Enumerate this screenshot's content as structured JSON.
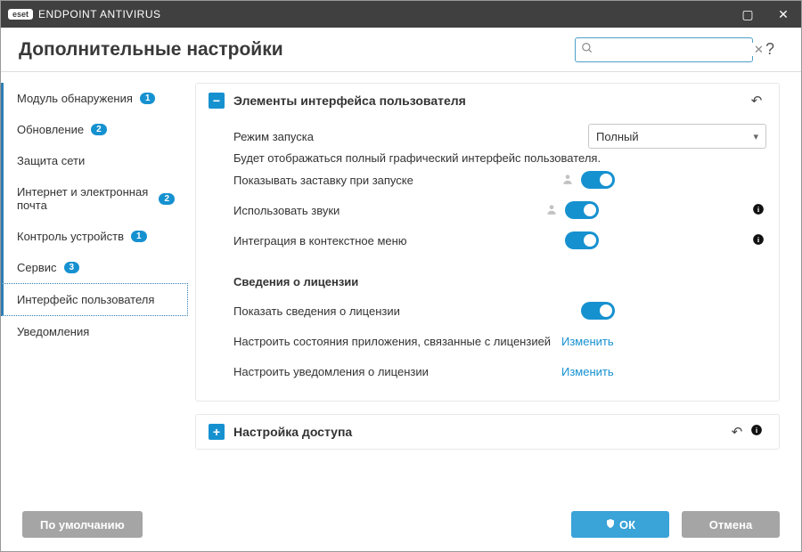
{
  "title": "ENDPOINT ANTIVIRUS",
  "brand": "eset",
  "header": {
    "page_title": "Дополнительные настройки"
  },
  "search": {
    "placeholder": ""
  },
  "sidebar": {
    "items": [
      {
        "label": "Модуль обнаружения",
        "badge": "1"
      },
      {
        "label": "Обновление",
        "badge": "2"
      },
      {
        "label": "Защита сети"
      },
      {
        "label": "Интернет и электронная почта",
        "badge": "2"
      },
      {
        "label": "Контроль устройств",
        "badge": "1"
      },
      {
        "label": "Сервис",
        "badge": "3"
      },
      {
        "label": "Интерфейс пользователя"
      },
      {
        "label": "Уведомления"
      }
    ]
  },
  "panel1": {
    "title": "Элементы интерфейса пользователя",
    "startmode_label": "Режим запуска",
    "startmode_value": "Полный",
    "startmode_hint": "Будет отображаться полный графический интерфейс пользователя.",
    "rows": {
      "splash": "Показывать заставку при запуске",
      "sounds": "Использовать звуки",
      "context": "Интеграция в контекстное меню"
    },
    "license_heading": "Сведения о лицензии",
    "license_show": "Показать сведения о лицензии",
    "license_states": "Настроить состояния приложения, связанные с лицензией",
    "license_notifs": "Настроить уведомления о лицензии",
    "edit": "Изменить"
  },
  "panel2": {
    "title": "Настройка доступа"
  },
  "footer": {
    "default": "По умолчанию",
    "ok": "ОК",
    "cancel": "Отмена"
  }
}
